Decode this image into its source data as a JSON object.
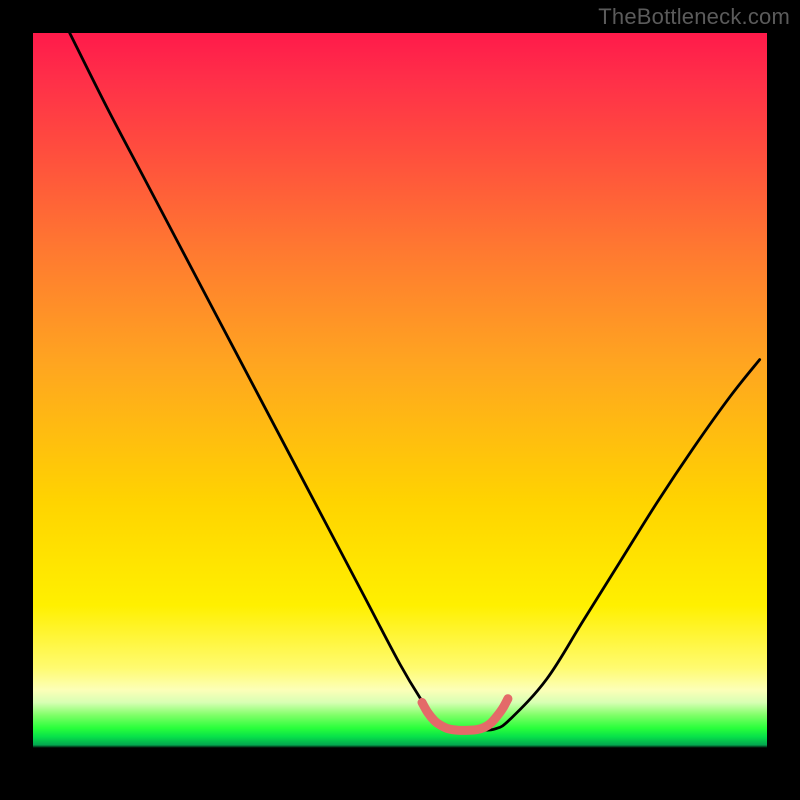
{
  "watermark": "TheBottleneck.com",
  "chart_data": {
    "type": "line",
    "title": "",
    "xlabel": "",
    "ylabel": "",
    "xlim": [
      0,
      100
    ],
    "ylim": [
      0,
      100
    ],
    "grid": false,
    "legend": false,
    "series": [
      {
        "name": "bottleneck-curve",
        "x": [
          5,
          10,
          15,
          20,
          25,
          30,
          35,
          40,
          45,
          50,
          53,
          55,
          57,
          59,
          61,
          63,
          65,
          70,
          75,
          80,
          85,
          90,
          95,
          99
        ],
        "y": [
          100,
          90,
          80.5,
          71,
          61.5,
          52,
          42.5,
          33,
          23.5,
          14,
          9,
          6.2,
          5.2,
          5.0,
          5.0,
          5.2,
          6.5,
          12,
          20,
          28,
          36,
          43.5,
          50.5,
          55.5
        ]
      },
      {
        "name": "highlight-band",
        "x": [
          53.0,
          53.8,
          54.7,
          55.5,
          56.6,
          58.0,
          59.2,
          60.5,
          61.5,
          62.4,
          63.2,
          64.0,
          64.7
        ],
        "y": [
          8.8,
          7.4,
          6.3,
          5.7,
          5.2,
          5.0,
          5.0,
          5.1,
          5.4,
          6.0,
          6.9,
          8.0,
          9.3
        ]
      }
    ],
    "annotations": [
      {
        "text": "TheBottleneck.com",
        "role": "watermark",
        "position": "top-right"
      }
    ],
    "background_gradient": {
      "orientation": "vertical",
      "stops": [
        {
          "pos": 0.0,
          "color": "#ff1a4a"
        },
        {
          "pos": 0.3,
          "color": "#ff7a30"
        },
        {
          "pos": 0.64,
          "color": "#ffd400"
        },
        {
          "pos": 0.88,
          "color": "#fffb70"
        },
        {
          "pos": 0.93,
          "color": "#7cff66"
        },
        {
          "pos": 0.96,
          "color": "#07e04a"
        },
        {
          "pos": 0.975,
          "color": "#000000"
        }
      ]
    },
    "colors": {
      "curve": "#000000",
      "highlight": "#e46a69",
      "frame": "#000000"
    }
  }
}
